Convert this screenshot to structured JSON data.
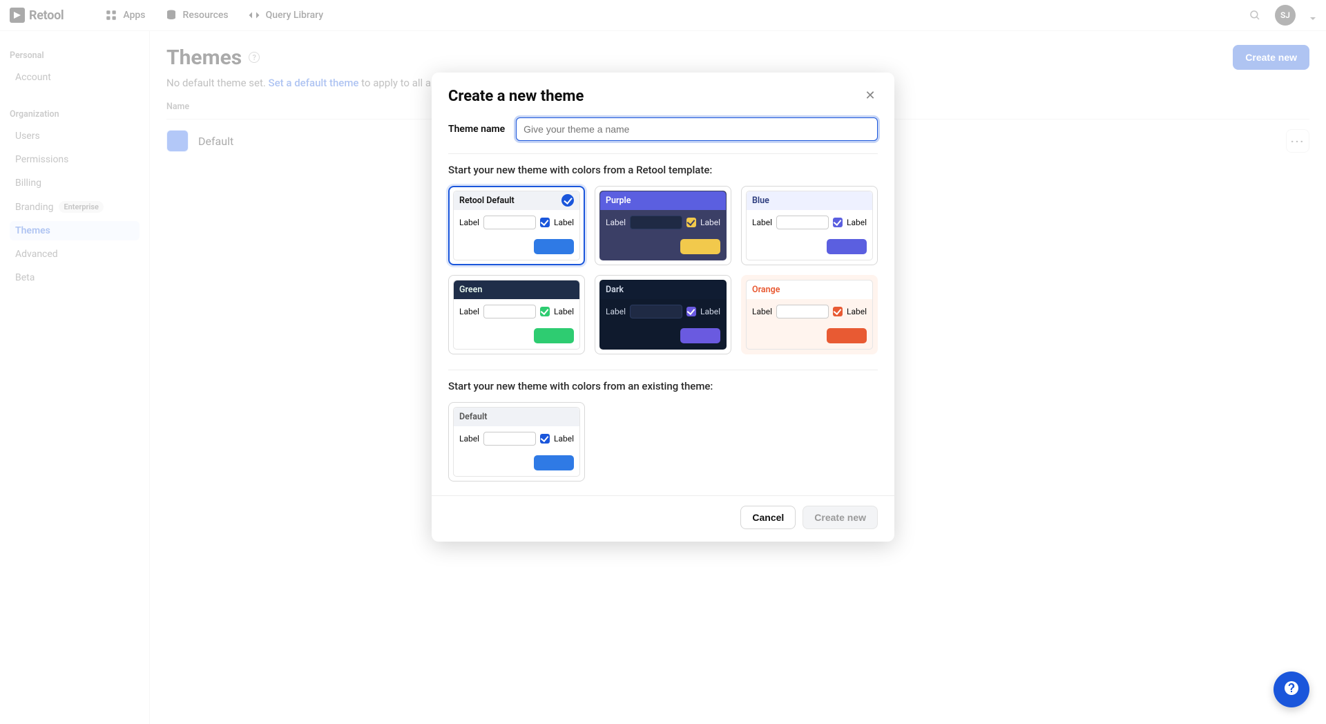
{
  "brand": {
    "name": "Retool"
  },
  "topnav": {
    "items": [
      {
        "label": "Apps"
      },
      {
        "label": "Resources"
      },
      {
        "label": "Query Library"
      }
    ],
    "avatar_initials": "SJ"
  },
  "sidebar": {
    "section_personal": "Personal",
    "section_organization": "Organization",
    "personal": {
      "account": "Account"
    },
    "org": {
      "users": "Users",
      "permissions": "Permissions",
      "billing": "Billing",
      "branding": "Branding",
      "branding_badge": "Enterprise",
      "themes": "Themes",
      "advanced": "Advanced",
      "beta": "Beta"
    }
  },
  "page": {
    "title": "Themes",
    "subtext_prefix": "No default theme set. ",
    "subtext_link": "Set a default theme",
    "subtext_suffix": " to apply to all apps without a theme set.",
    "create_button": "Create new",
    "table": {
      "col_name": "Name",
      "row0": {
        "name": "Default"
      }
    }
  },
  "modal": {
    "title": "Create a new theme",
    "theme_name_label": "Theme name",
    "theme_name_placeholder": "Give your theme a name",
    "section_templates": "Start your new theme with colors from a Retool template:",
    "section_existing": "Start your new theme with colors from an existing theme:",
    "templates": {
      "retool_default": "Retool Default",
      "purple": "Purple",
      "blue": "Blue",
      "green": "Green",
      "dark": "Dark",
      "orange": "Orange"
    },
    "existing": {
      "default": "Default"
    },
    "card_label": "Label",
    "footer": {
      "cancel": "Cancel",
      "create_new": "Create new"
    }
  }
}
